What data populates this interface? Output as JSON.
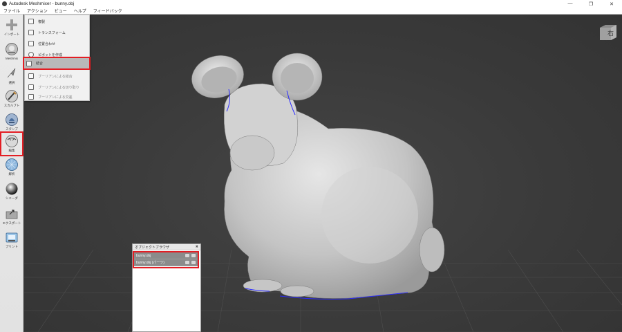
{
  "window": {
    "title": "Autodesk Meshmixer - bunny.obj",
    "controls": {
      "minimize": "—",
      "maximize": "❐",
      "close": "✕"
    }
  },
  "menubar": {
    "items": [
      "ファイル",
      "アクション",
      "ビュー",
      "ヘルプ",
      "フィードバック"
    ]
  },
  "toolbar": {
    "items": [
      {
        "label": "インポート",
        "icon": "plus-icon"
      },
      {
        "label": "Meshmix",
        "icon": "meshmix-sphere-icon"
      },
      {
        "label": "選択",
        "icon": "select-arrow-icon"
      },
      {
        "label": "スカルプト",
        "icon": "sculpt-brush-icon"
      },
      {
        "label": "スタンプ",
        "icon": "stamp-icon"
      },
      {
        "label": "編集",
        "icon": "edit-sphere-icon"
      },
      {
        "label": "解析",
        "icon": "analysis-sphere-icon"
      },
      {
        "label": "シェーダ",
        "icon": "shader-sphere-icon"
      },
      {
        "label": "エクスポート",
        "icon": "export-icon"
      },
      {
        "label": "プリント",
        "icon": "print-icon"
      }
    ]
  },
  "edit_menu": {
    "items": [
      {
        "label": "複製",
        "icon": "duplicate-icon",
        "state": "enabled"
      },
      {
        "label": "トランスフォーム",
        "icon": "transform-icon",
        "state": "enabled"
      },
      {
        "label": "位置合わせ",
        "icon": "align-icon",
        "state": "enabled"
      },
      {
        "label": "ピボットを作成",
        "icon": "pivot-icon",
        "state": "enabled"
      },
      {
        "label": "結合",
        "icon": "combine-icon",
        "state": "selected"
      },
      {
        "label": "ブーリアンによる結合",
        "icon": "boolean-union-icon",
        "state": "disabled"
      },
      {
        "label": "ブーリアンによる切り取り",
        "icon": "boolean-difference-icon",
        "state": "disabled"
      },
      {
        "label": "ブーリアンによる交差",
        "icon": "boolean-intersect-icon",
        "state": "disabled"
      }
    ]
  },
  "viewcube": {
    "face_label": "右"
  },
  "object_browser": {
    "title": "オブジェクトブラウザ",
    "close": "✖",
    "items": [
      {
        "name": "bunny.obj"
      },
      {
        "name": "bunny.obj (パーツ)"
      }
    ]
  },
  "colors": {
    "highlight": "#e31e24",
    "viewport_bg": "#3c3c3c",
    "mesh": "#c9c9c9",
    "selection_edge": "#2b2bff"
  }
}
